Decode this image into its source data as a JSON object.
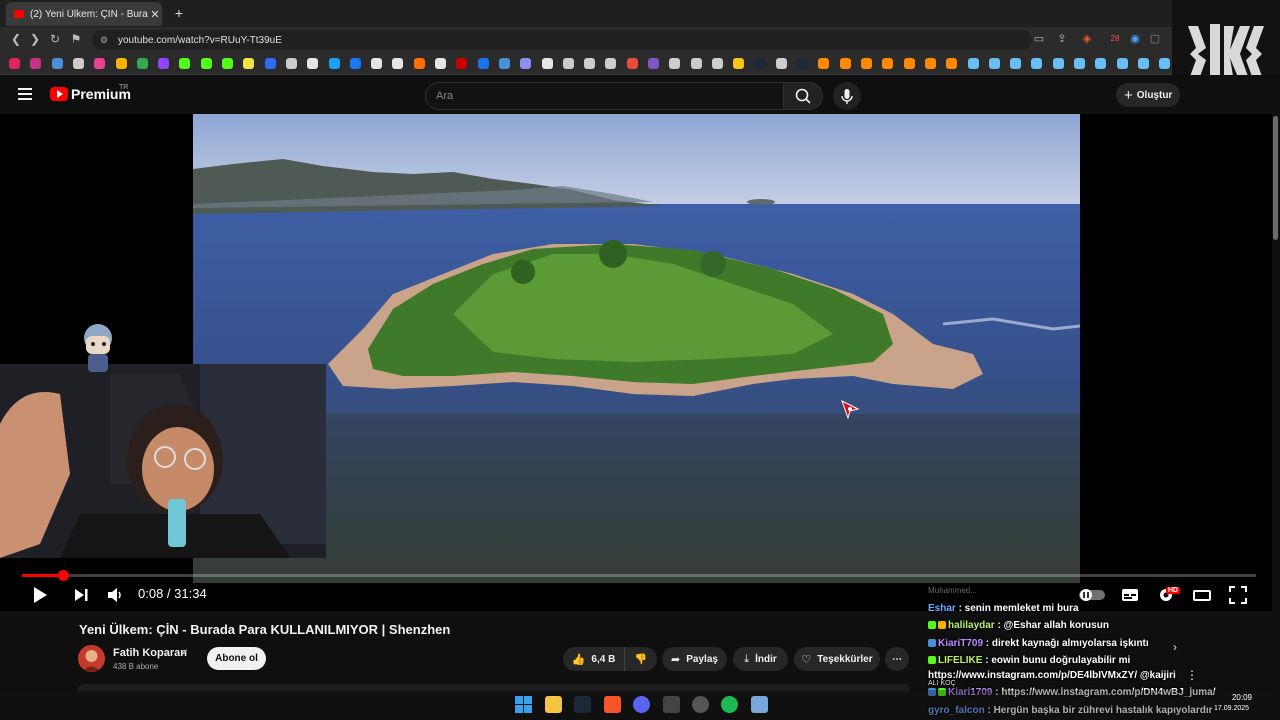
{
  "browser": {
    "tab_title": "(2) Yeni Ülkem: ÇİN - Burada Para",
    "url": "youtube.com/watch?v=RUuY-Tt39uE",
    "bookmark_colors": [
      "#e0245e",
      "#c13584",
      "#4a90d9",
      "#cccccc",
      "#e84393",
      "#f4b400",
      "#34a853",
      "#9147ff",
      "#53fc18",
      "#53fc18",
      "#53fc18",
      "#f4e242",
      "#2e6df6",
      "#cccccc",
      "#e6e6e6",
      "#1da1f2",
      "#1877f2",
      "#e6e6e6",
      "#e6e6e6",
      "#ff6f00",
      "#e6e6e6",
      "#cc0000",
      "#1a73e8",
      "#4a90d9",
      "#8e8ef0",
      "#e6e6e6",
      "#cccccc",
      "#cccccc",
      "#cccccc",
      "#e74c3c",
      "#7e57c2",
      "#cccccc",
      "#cccccc",
      "#cccccc",
      "#f5c518",
      "#1b2838",
      "#cccccc",
      "#1b2838",
      "#ff8a00",
      "#ff8a00",
      "#ff8a00",
      "#ff8a00",
      "#ff8a00",
      "#ff8a00",
      "#ff8a00",
      "#66c0f4",
      "#66c0f4",
      "#66c0f4",
      "#66c0f4",
      "#66c0f4",
      "#66c0f4",
      "#66c0f4",
      "#66c0f4",
      "#66c0f4",
      "#66c0f4"
    ],
    "badge_count": "28"
  },
  "header": {
    "brand": "Premium",
    "country": "TR",
    "search_placeholder": "Ara",
    "create_label": "Oluştur"
  },
  "player": {
    "progress": 0.0042,
    "time_current": "0:08",
    "time_total": "31:34",
    "time_display": "0:08 / 31:34",
    "hd_badge": "HD"
  },
  "video": {
    "title": "Yeni Ülkem: ÇİN - Burada Para KULLANILMIYOR | Shenzhen",
    "channel": "Fatih Koparan",
    "subscribers": "438 B abone",
    "subscribe_label": "Abone ol",
    "likes": "6,4 B",
    "share_label": "Paylaş",
    "download_label": "İndir",
    "thanks_label": "Teşekkürler"
  },
  "chat": {
    "lines": [
      {
        "user": "Eshar",
        "msg": " : senin memleket mi bura",
        "color": "#6fa8ff"
      },
      {
        "user": "halilaydar",
        "msg": " : @Eshar allah korusun",
        "color": "#b7f069"
      },
      {
        "user": "KiariT709",
        "msg": " : direkt kaynağı almıyolarsa işkıntı",
        "color": "#bb8cff"
      },
      {
        "user": "LIFELIKE",
        "msg": " : eowin bunu doğrulayabilir mi",
        "color": "#b7f069"
      },
      {
        "user": "",
        "msg": "https://www.instagram.com/p/DE4lbIVMxZY/ @kaijiri",
        "color": "#ffffff"
      },
      {
        "user": "Kiari1709",
        "msg": " : https://www.instagram.com/p/DN4wBJ_juma/",
        "color": "#bb8cff"
      },
      {
        "user": "gyro_falcon",
        "msg": " : Hergün başka bir zührevi hastalık kapıyolardır",
        "color": "#6fa8ff"
      }
    ],
    "partial_top": "Muhammed..."
  },
  "system": {
    "time": "20:09",
    "date": "17.09.2025",
    "overlay_text": "ALİ KOÇ"
  }
}
